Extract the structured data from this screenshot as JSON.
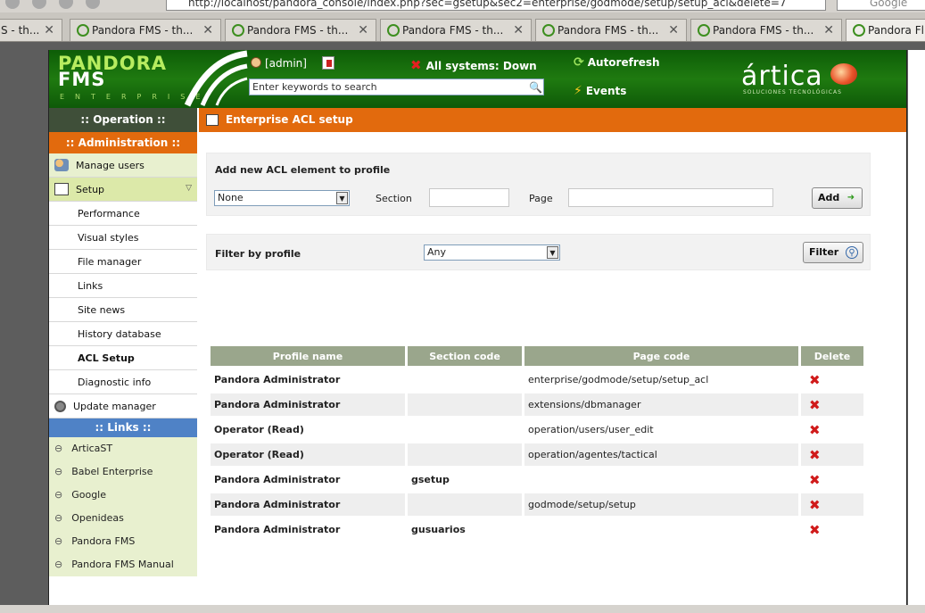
{
  "browser": {
    "url": "http://localhost/pandora_console/index.php?sec=gsetup&sec2=enterprise/godmode/setup/setup_acl&delete=7",
    "search_placeholder": "Google",
    "tabs": [
      {
        "label": "S - th..."
      },
      {
        "label": "Pandora FMS - th..."
      },
      {
        "label": "Pandora FMS - th..."
      },
      {
        "label": "Pandora FMS - th..."
      },
      {
        "label": "Pandora FMS - th..."
      },
      {
        "label": "Pandora FMS - th..."
      },
      {
        "label": "Pandora Fl"
      }
    ]
  },
  "header": {
    "logo_main": "PANDORA",
    "logo_fms": "FMS",
    "logo_sub": "ENTERPRISE",
    "user": "[admin]",
    "search_placeholder": "Enter keywords to search",
    "systems_status": "All systems: Down",
    "autorefresh": "Autorefresh",
    "events": "Events",
    "brand": "ártica",
    "brand_sub": "SOLUCIONES TECNOLÓGICAS"
  },
  "sidebar": {
    "operation": ":: Operation ::",
    "administration": ":: Administration ::",
    "admin_items": [
      {
        "label": "Manage users"
      },
      {
        "label": "Setup"
      },
      {
        "label": "Performance"
      },
      {
        "label": "Visual styles"
      },
      {
        "label": "File manager"
      },
      {
        "label": "Links"
      },
      {
        "label": "Site news"
      },
      {
        "label": "History database"
      },
      {
        "label": "ACL Setup"
      },
      {
        "label": "Diagnostic info"
      },
      {
        "label": "Update manager"
      }
    ],
    "links_head": ":: Links ::",
    "links": [
      {
        "label": "ArticaST"
      },
      {
        "label": "Babel Enterprise"
      },
      {
        "label": "Google"
      },
      {
        "label": "Openideas"
      },
      {
        "label": "Pandora FMS"
      },
      {
        "label": "Pandora FMS Manual"
      }
    ]
  },
  "main": {
    "title": "Enterprise ACL setup",
    "add_box": {
      "title": "Add new ACL element to profile",
      "profile_select": "None",
      "section_label": "Section",
      "page_label": "Page",
      "add_button": "Add"
    },
    "filter_box": {
      "title": "Filter by profile",
      "profile_select": "Any",
      "filter_button": "Filter"
    },
    "table": {
      "headers": [
        "Profile name",
        "Section code",
        "Page code",
        "Delete"
      ],
      "rows": [
        {
          "profile": "Pandora Administrator",
          "section": "",
          "page": "enterprise/godmode/setup/setup_acl"
        },
        {
          "profile": "Pandora Administrator",
          "section": "",
          "page": "extensions/dbmanager"
        },
        {
          "profile": "Operator (Read)",
          "section": "",
          "page": "operation/users/user_edit"
        },
        {
          "profile": "Operator (Read)",
          "section": "",
          "page": "operation/agentes/tactical"
        },
        {
          "profile": "Pandora Administrator",
          "section": "gsetup",
          "page": ""
        },
        {
          "profile": "Pandora Administrator",
          "section": "",
          "page": "godmode/setup/setup"
        },
        {
          "profile": "Pandora Administrator",
          "section": "gusuarios",
          "page": ""
        }
      ]
    }
  },
  "colors": {
    "accent_orange": "#e26a0d",
    "header_green": "#1f7a10",
    "table_header": "#9aa68c",
    "links_blue": "#4f82c6",
    "delete_red": "#d01a1a"
  }
}
